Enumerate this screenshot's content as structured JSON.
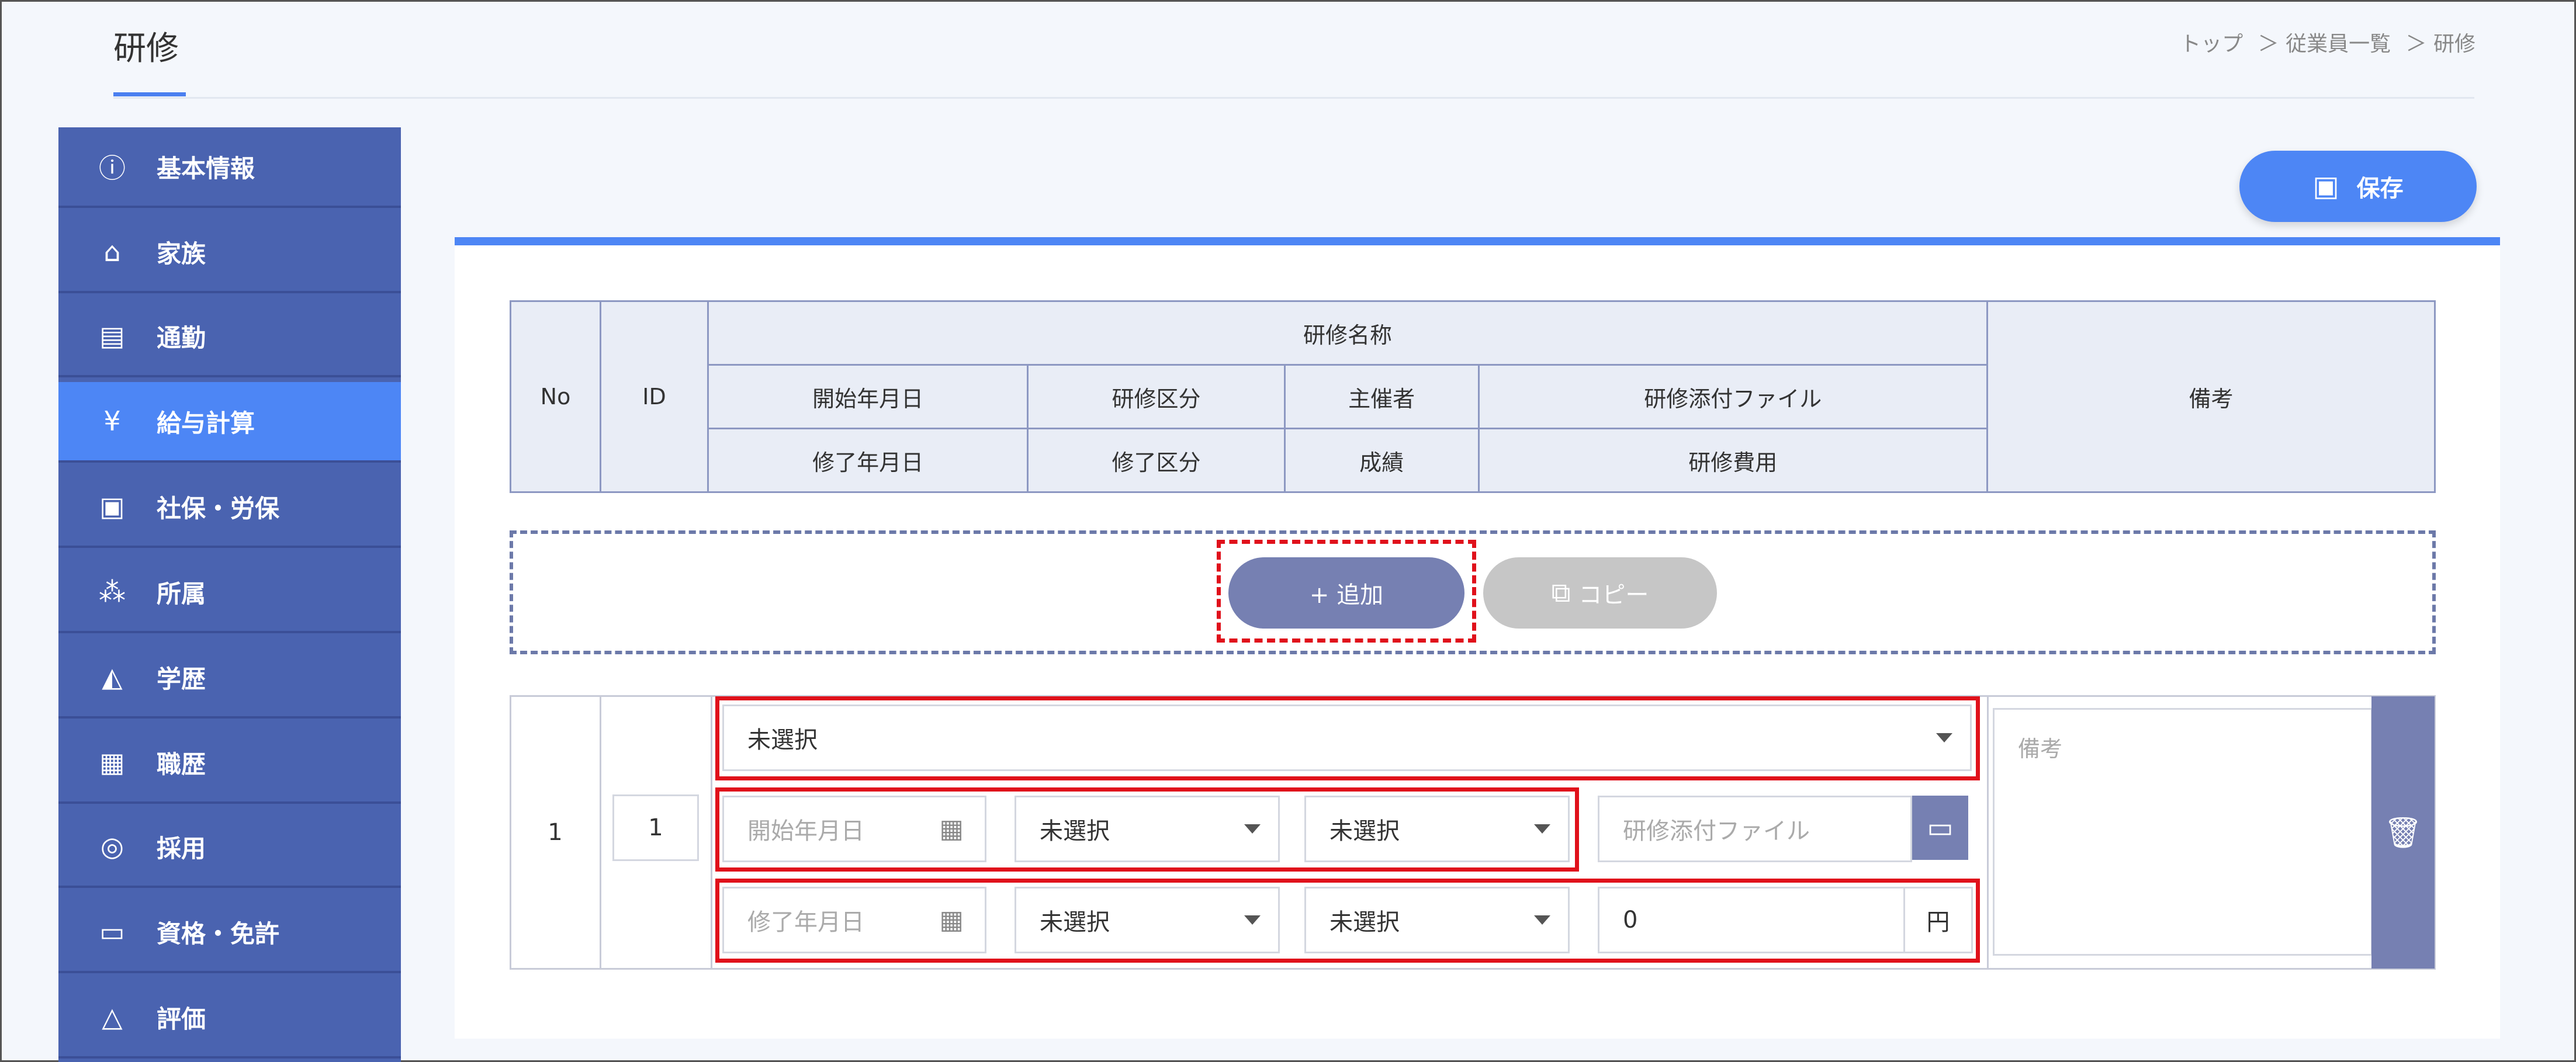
{
  "header": {
    "title": "研修",
    "breadcrumb": [
      "トップ",
      "＞ 従業員一覧",
      "＞ 研修"
    ]
  },
  "sidebar": {
    "items": [
      {
        "label": "基本情報",
        "icon": "info-icon"
      },
      {
        "label": "家族",
        "icon": "house-icon"
      },
      {
        "label": "通勤",
        "icon": "train-icon"
      },
      {
        "label": "給与計算",
        "icon": "yen-icon"
      },
      {
        "label": "社保・労保",
        "icon": "document-icon"
      },
      {
        "label": "所属",
        "icon": "organization-icon"
      },
      {
        "label": "学歴",
        "icon": "graduation-cap-icon"
      },
      {
        "label": "職歴",
        "icon": "briefcase-icon"
      },
      {
        "label": "採用",
        "icon": "search-person-icon"
      },
      {
        "label": "資格・免許",
        "icon": "id-card-icon"
      },
      {
        "label": "評価",
        "icon": "compass-icon"
      }
    ],
    "active_index": 3
  },
  "toolbar": {
    "save_label": "保存"
  },
  "table_header": {
    "no": "No",
    "id": "ID",
    "training_name": "研修名称",
    "start_date": "開始年月日",
    "training_category": "研修区分",
    "organizer": "主催者",
    "attachment": "研修添付ファイル",
    "end_date": "修了年月日",
    "completion_category": "修了区分",
    "grade": "成績",
    "cost": "研修費用",
    "remarks": "備考"
  },
  "actions": {
    "add_label": "+ 追加",
    "copy_label": "コピー"
  },
  "row": {
    "no": "1",
    "id": "1",
    "training_name": "未選択",
    "start_date_placeholder": "開始年月日",
    "training_category": "未選択",
    "organizer": "未選択",
    "attachment_placeholder": "研修添付ファイル",
    "end_date_placeholder": "修了年月日",
    "completion_category": "未選択",
    "grade": "未選択",
    "cost": "0",
    "cost_unit": "円",
    "remarks_placeholder": "備考"
  },
  "colors": {
    "accent": "#4d86f5",
    "sidebar": "#4a63b0",
    "highlight": "#e0111b",
    "button": "#7680b2"
  }
}
